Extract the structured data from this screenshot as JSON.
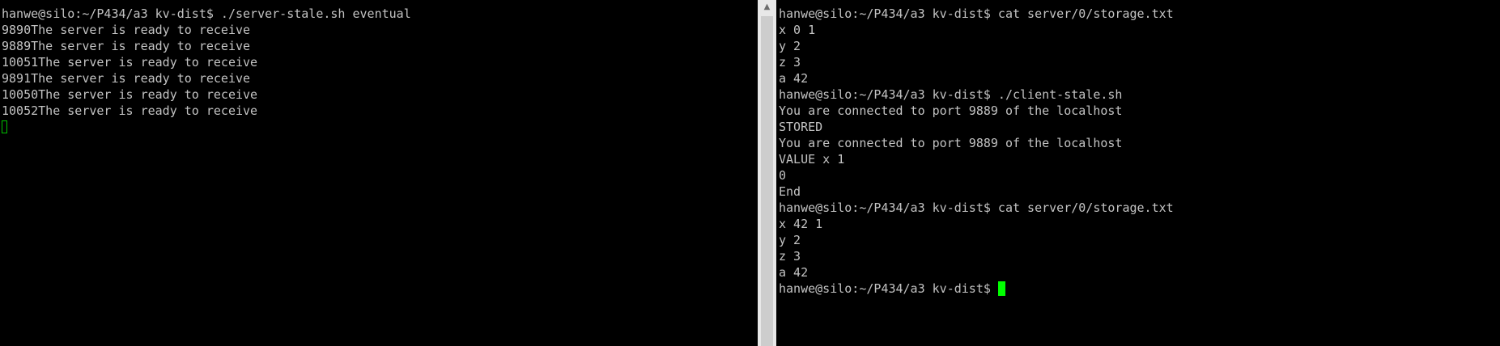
{
  "left_terminal": {
    "lines": [
      "hanwe@silo:~/P434/a3 kv-dist$ ./server-stale.sh eventual",
      "9890The server is ready to receive",
      "9889The server is ready to receive",
      "10051The server is ready to receive",
      "9891The server is ready to receive",
      "10050The server is ready to receive",
      "10052The server is ready to receive"
    ]
  },
  "right_terminal": {
    "lines": [
      "hanwe@silo:~/P434/a3 kv-dist$ cat server/0/storage.txt",
      "x 0 1",
      "y 2",
      "z 3",
      "a 42",
      "hanwe@silo:~/P434/a3 kv-dist$ ./client-stale.sh",
      "You are connected to port 9889 of the localhost",
      "STORED",
      "You are connected to port 9889 of the localhost",
      "VALUE x 1",
      "0",
      "End",
      "hanwe@silo:~/P434/a3 kv-dist$ cat server/0/storage.txt",
      "x 42 1",
      "y 2",
      "z 3",
      "a 42"
    ],
    "prompt": "hanwe@silo:~/P434/a3 kv-dist$ "
  },
  "scrollbar": {
    "up_arrow_icon": "▲"
  },
  "colors": {
    "background": "#000000",
    "text": "#c3c3c3",
    "cursor": "#00ff00"
  }
}
